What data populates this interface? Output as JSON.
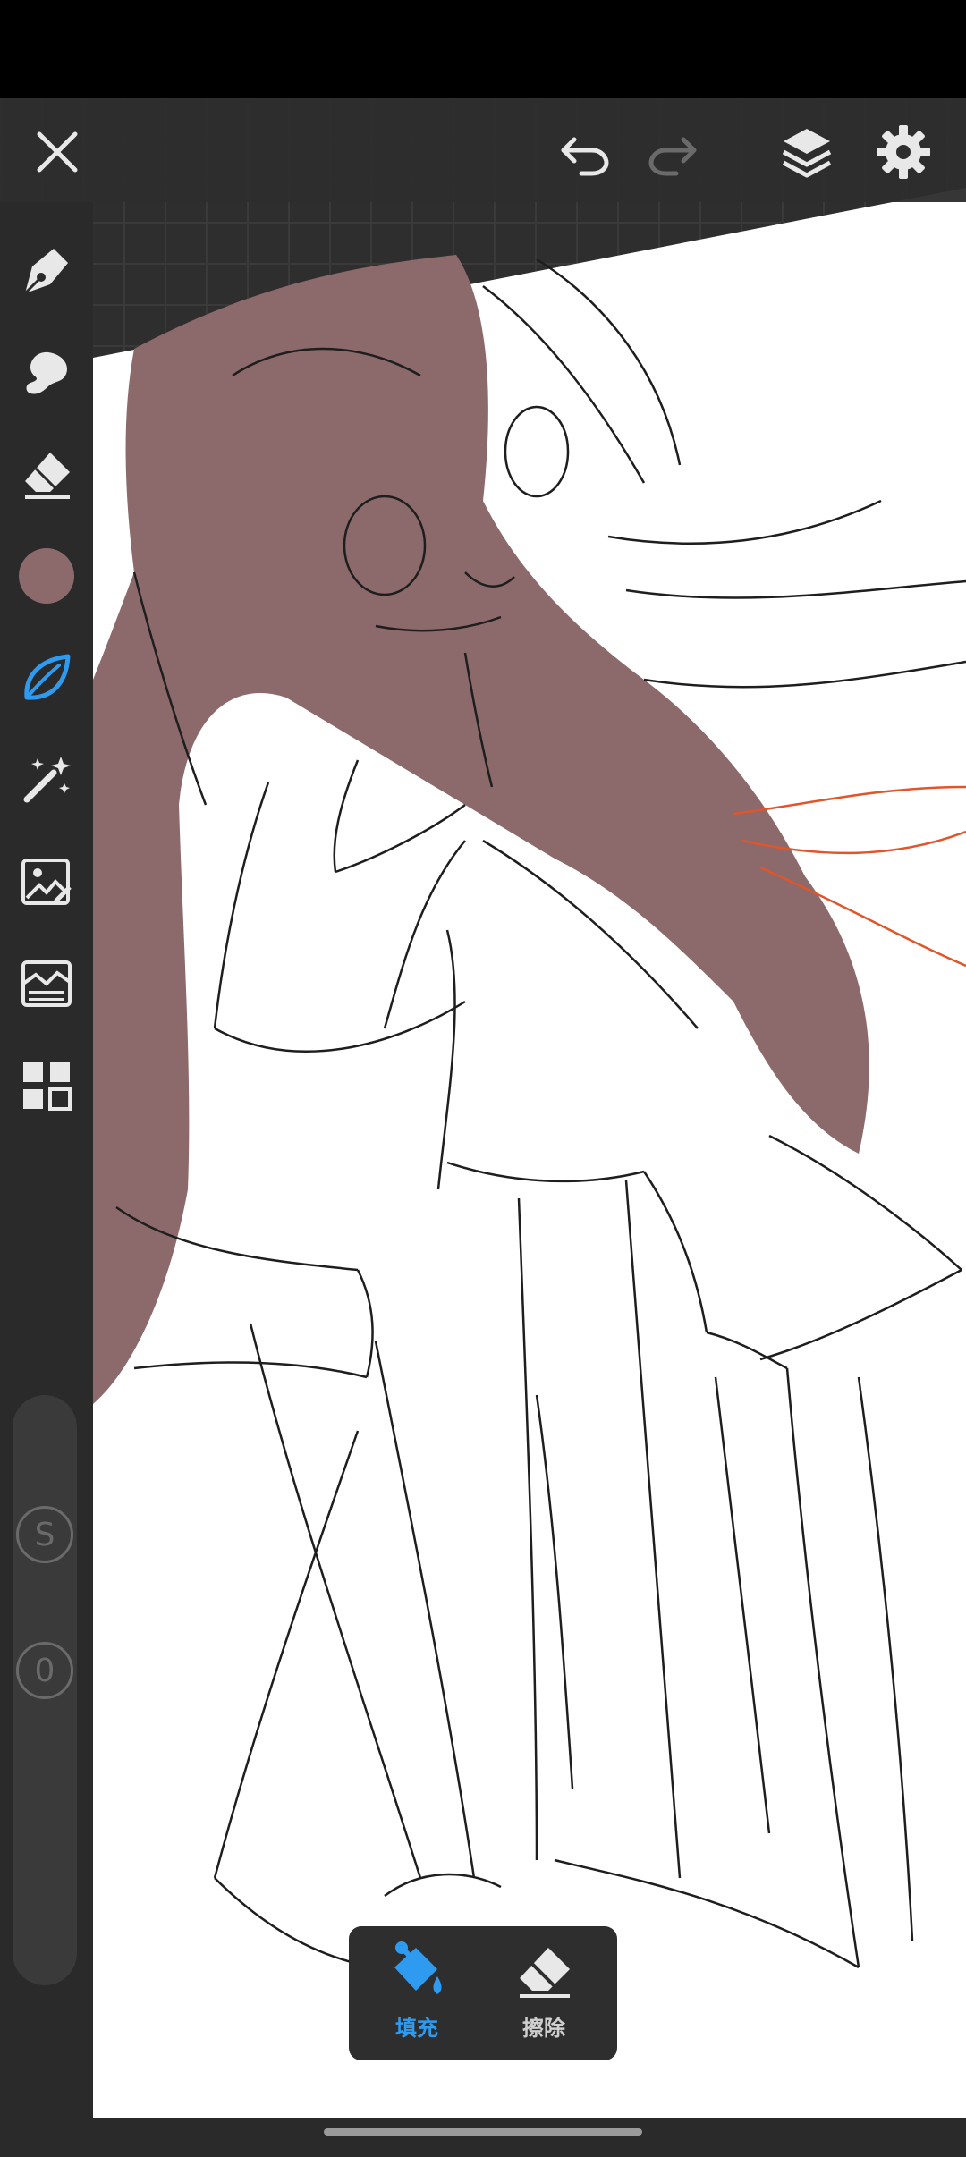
{
  "app": {
    "colors": {
      "accent": "#2e9bf0",
      "current_color": "#8c6a6c",
      "hair_fill": "#8c6a6c",
      "icon": "#e8e8e8",
      "icon_disabled": "#6a6a6a",
      "guide_lines": "#e0552a"
    }
  },
  "toolbar": {
    "close": {
      "icon": "close-icon"
    },
    "undo": {
      "icon": "undo-icon",
      "enabled": true
    },
    "redo": {
      "icon": "redo-icon",
      "enabled": false
    },
    "layers": {
      "icon": "layers-icon"
    },
    "settings": {
      "icon": "gear-icon"
    }
  },
  "sidebar": {
    "tools": [
      {
        "name": "brush",
        "icon": "brush-tip-icon",
        "active": false
      },
      {
        "name": "smudge",
        "icon": "smudge-icon",
        "active": false
      },
      {
        "name": "eraser",
        "icon": "eraser-icon",
        "active": false
      },
      {
        "name": "color",
        "icon": "color-swatch",
        "active": false
      },
      {
        "name": "fill",
        "icon": "leaf-fill-icon",
        "active": true
      },
      {
        "name": "magic-wand",
        "icon": "magic-wand-icon",
        "active": false
      },
      {
        "name": "image-adjust",
        "icon": "image-edit-icon",
        "active": false
      },
      {
        "name": "filter",
        "icon": "filter-icon",
        "active": false
      },
      {
        "name": "gallery",
        "icon": "grid-icon",
        "active": false
      }
    ],
    "size_button": {
      "label": "S"
    },
    "opacity_button": {
      "label": "0"
    }
  },
  "fill_panel": {
    "fill_label": "填充",
    "erase_label": "擦除",
    "active": "fill"
  }
}
